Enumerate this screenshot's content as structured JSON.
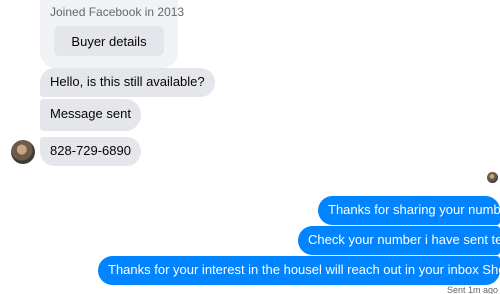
{
  "seller_card": {
    "joined_text": "Joined Facebook in 2013",
    "buyer_details_label": "Buyer details"
  },
  "incoming_messages": [
    "Hello, is this still available?",
    "Message sent",
    "828-729-6890"
  ],
  "outgoing_messages": [
    "Thanks for sharing your number",
    "Check your number i have sent text",
    "Thanks for your interest in the housel will reach out in your inbox Shortly"
  ],
  "status_text": "Sent 1m ago",
  "colors": {
    "outgoing_bubble": "#0084ff",
    "incoming_bubble": "#e4e6eb",
    "card_background": "#f0f2f5",
    "muted_text": "#65676b"
  },
  "icons": {
    "contact_avatar": "avatar",
    "seen_indicator": "seen-avatar-icon"
  }
}
